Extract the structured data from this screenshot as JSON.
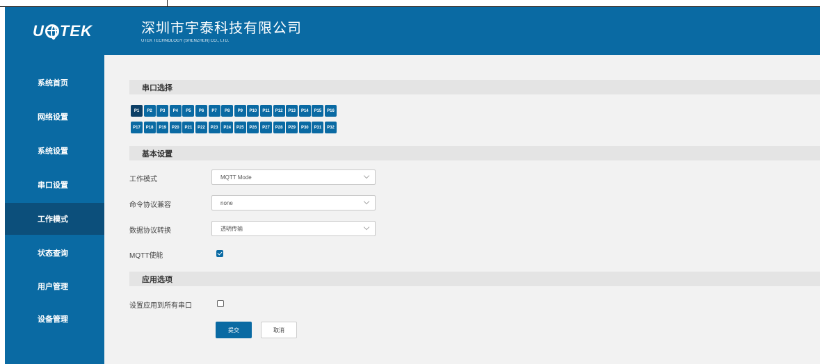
{
  "header": {
    "logo": "UOTEK",
    "company_cn": "深圳市宇泰科技有限公司",
    "company_en": "UTEK TECHNOLOGY (SHENZHEN) CO., LTD."
  },
  "sidebar": {
    "items": [
      {
        "label": "系统首页"
      },
      {
        "label": "网络设置"
      },
      {
        "label": "系统设置"
      },
      {
        "label": "串口设置"
      },
      {
        "label": "工作模式"
      },
      {
        "label": "状态查询"
      },
      {
        "label": "用户管理"
      },
      {
        "label": "设备管理"
      }
    ],
    "active_index": 4
  },
  "sections": {
    "serial_select": "串口选择",
    "basic_settings": "基本设置",
    "apply_options": "应用选项"
  },
  "ports": [
    "P1",
    "P2",
    "P3",
    "P4",
    "P5",
    "P6",
    "P7",
    "P8",
    "P9",
    "P10",
    "P11",
    "P12",
    "P13",
    "P14",
    "P15",
    "P16",
    "P17",
    "P18",
    "P19",
    "P20",
    "P21",
    "P22",
    "P23",
    "P24",
    "P25",
    "P26",
    "P27",
    "P28",
    "P29",
    "P30",
    "P31",
    "P32"
  ],
  "selected_port": "P1",
  "form": {
    "work_mode_label": "工作模式",
    "work_mode_value": "MQTT Mode",
    "cmd_protocol_label": "命令协议兼容",
    "cmd_protocol_value": "none",
    "data_protocol_label": "数据协议转换",
    "data_protocol_value": "透明传输",
    "mqtt_enable_label": "MQTT使能",
    "mqtt_enable_checked": true,
    "apply_all_label": "设置应用到所有串口",
    "apply_all_checked": false
  },
  "buttons": {
    "submit": "提交",
    "cancel": "取消"
  },
  "colors": {
    "brand_blue": "#0a6aa3",
    "active_nav": "#0c4f7b"
  }
}
